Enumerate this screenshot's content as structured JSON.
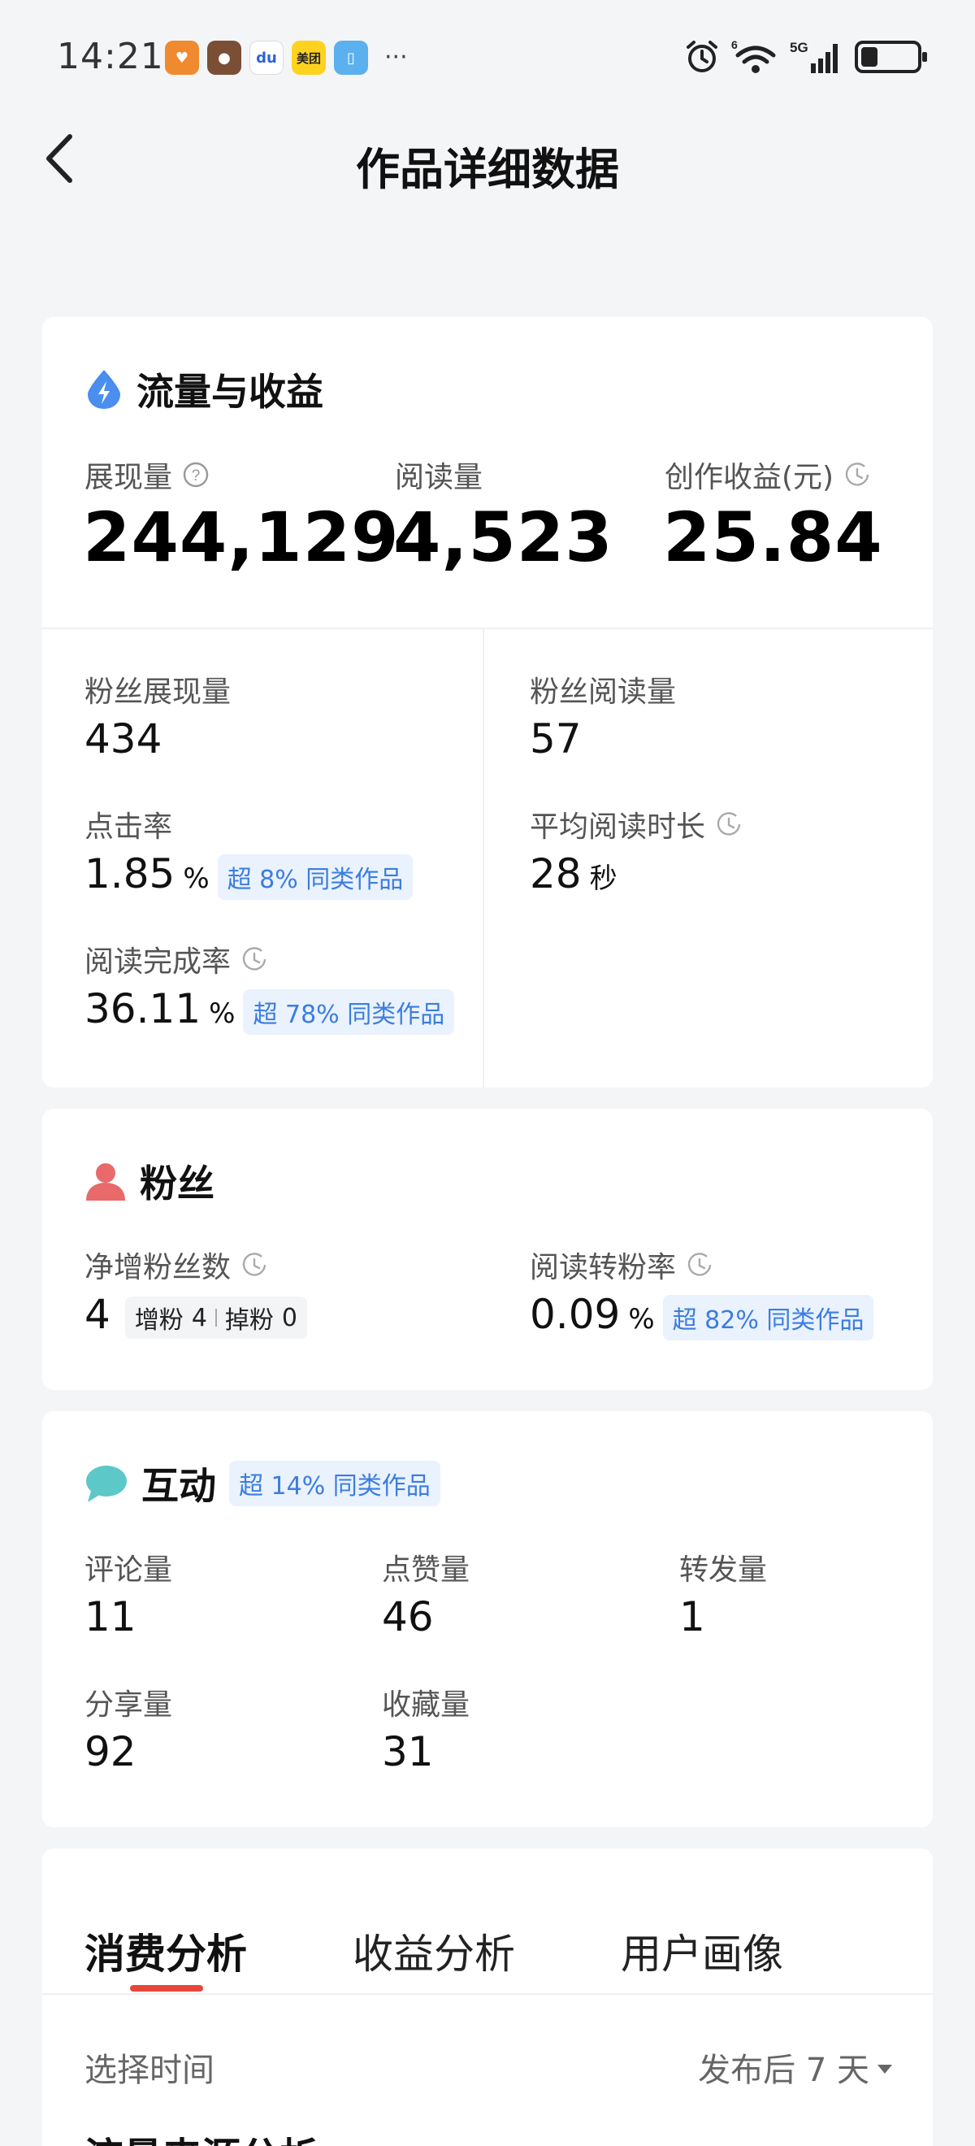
{
  "status_bar": {
    "time": "14:21",
    "apps": [
      {
        "icon": "heart-app-icon",
        "color": "#f08a2e",
        "glyph": "♥"
      },
      {
        "icon": "game-app-icon",
        "color": "#8a5a3a",
        "glyph": "●"
      },
      {
        "icon": "baidu-app-icon",
        "color": "#ffffff",
        "glyph": "du"
      },
      {
        "icon": "meituan-app-icon",
        "color": "#ffd21f",
        "glyph": "美团"
      },
      {
        "icon": "book-app-icon",
        "color": "#5ab1ee",
        "glyph": "▯"
      }
    ],
    "more": "···",
    "network": "5G",
    "wifi_badge": "6",
    "battery_level": 0.3
  },
  "nav": {
    "title": "作品详细数据"
  },
  "traffic": {
    "title": "流量与收益",
    "impressions_label": "展现量",
    "impressions": "244,129",
    "reads_label": "阅读量",
    "reads": "4,523",
    "earnings_label": "创作收益(元)",
    "earnings": "25.84",
    "fan_impressions_label": "粉丝展现量",
    "fan_impressions": "434",
    "fan_reads_label": "粉丝阅读量",
    "fan_reads": "57",
    "ctr_label": "点击率",
    "ctr": "1.85",
    "ctr_unit": "%",
    "ctr_tag": "超 8% 同类作品",
    "avg_read_label": "平均阅读时长",
    "avg_read": "28",
    "avg_read_unit": "秒",
    "completion_label": "阅读完成率",
    "completion": "36.11",
    "completion_unit": "%",
    "completion_tag": "超 78% 同类作品"
  },
  "fans": {
    "title": "粉丝",
    "net_label": "净增粉丝数",
    "net": "4",
    "gain_label": "增粉",
    "gain": "4",
    "loss_label": "掉粉",
    "loss": "0",
    "conv_label": "阅读转粉率",
    "conv": "0.09",
    "conv_unit": "%",
    "conv_tag": "超 82% 同类作品"
  },
  "interaction": {
    "title": "互动",
    "tag": "超 14% 同类作品",
    "comments_label": "评论量",
    "comments": "11",
    "likes_label": "点赞量",
    "likes": "46",
    "reposts_label": "转发量",
    "reposts": "1",
    "shares_label": "分享量",
    "shares": "92",
    "favorites_label": "收藏量",
    "favorites": "31"
  },
  "analysis": {
    "tabs": [
      "消费分析",
      "收益分析",
      "用户画像"
    ],
    "active_tab": 0,
    "filter_label": "选择时间",
    "filter_value": "发布后 7 天",
    "section_peek": "流量来源分析"
  },
  "colors": {
    "accent_red": "#e8463a",
    "tag_blue": "#3b7de0",
    "icon_blue": "#4a8ef0",
    "icon_red": "#e86a6a",
    "icon_teal": "#5cc8c8"
  }
}
